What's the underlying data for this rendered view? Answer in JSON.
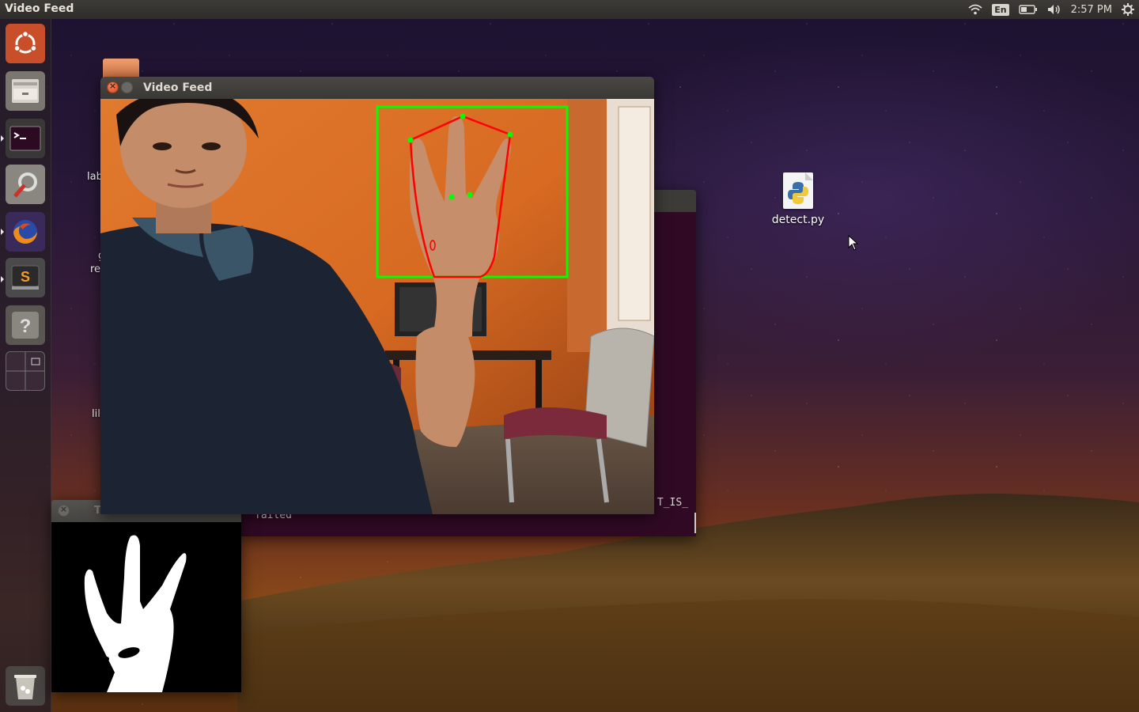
{
  "top_panel": {
    "active_app_title": "Video Feed",
    "keyboard_layout": "En",
    "clock": "2:57 PM",
    "tray_icons": [
      "wifi-icon",
      "keyboard-layout-icon",
      "battery-icon",
      "volume-icon",
      "settings-gear-icon"
    ]
  },
  "launcher": {
    "items": [
      {
        "name": "ubuntu-dash",
        "icon": "ubuntu-logo-icon"
      },
      {
        "name": "files",
        "icon": "file-cabinet-icon"
      },
      {
        "name": "terminal",
        "icon": "terminal-icon"
      },
      {
        "name": "system-settings",
        "icon": "settings-tools-icon"
      },
      {
        "name": "firefox",
        "icon": "firefox-icon"
      },
      {
        "name": "sublime-text",
        "icon": "sublime-text-icon"
      },
      {
        "name": "help",
        "icon": "question-mark-icon"
      },
      {
        "name": "workspace-switcher",
        "icon": "workspaces-icon"
      },
      {
        "name": "trash",
        "icon": "trash-icon"
      }
    ]
  },
  "desktop": {
    "icons": [
      {
        "label": "detect.py",
        "icon": "python-file-icon"
      }
    ],
    "partial_labels": [
      "lab",
      "g",
      "re",
      "lil"
    ]
  },
  "windows": {
    "video_feed": {
      "title": "Video Feed"
    },
    "thresholded": {
      "title": "Thresholded"
    },
    "terminal": {
      "line_right": "T_IS_",
      "line_bottom": "failed"
    }
  },
  "colors": {
    "panel_bg": "#3c3b37",
    "terminal_bg": "#300a24",
    "bounding_box": "#00ff00",
    "hull_line": "#ff0000",
    "close_button": "#e0562c"
  }
}
